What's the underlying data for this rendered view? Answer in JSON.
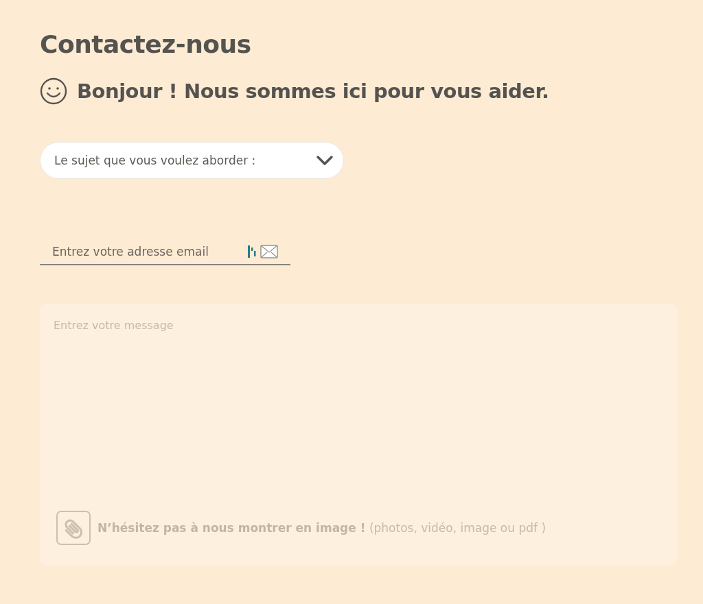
{
  "page_title": "Contactez-nous",
  "greeting": "Bonjour ! Nous sommes ici pour vous aider.",
  "subject_select": {
    "placeholder": "Le sujet que vous voulez aborder :"
  },
  "email_field": {
    "placeholder": "Entrez votre adresse email"
  },
  "message_field": {
    "placeholder": "Entrez votre message"
  },
  "attachment_hint": "**N’hésitez pas à nous montrer en image !** (photos, vidéo, image ou pdf )"
}
